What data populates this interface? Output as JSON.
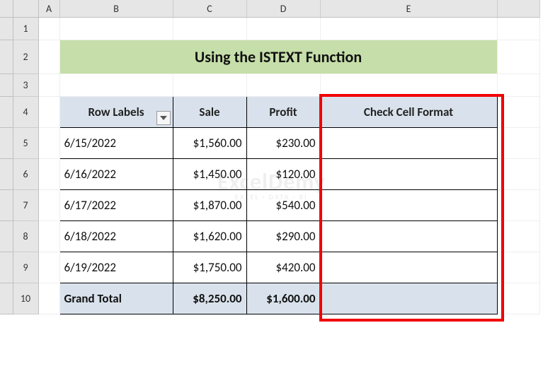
{
  "columns": [
    "A",
    "B",
    "C",
    "D",
    "E"
  ],
  "rows": [
    "1",
    "2",
    "3",
    "4",
    "5",
    "6",
    "7",
    "8",
    "9",
    "10"
  ],
  "title": "Using the ISTEXT Function",
  "headers": {
    "row_labels": "Row Labels",
    "sale": "Sale",
    "profit": "Profit",
    "check": "Check Cell Format"
  },
  "chart_data": {
    "type": "table",
    "columns": [
      "Row Labels",
      "Sale",
      "Profit",
      "Check Cell Format"
    ],
    "rows": [
      {
        "label": "6/15/2022",
        "sale": "$1,560.00",
        "profit": "$230.00",
        "check": ""
      },
      {
        "label": "6/16/2022",
        "sale": "$1,450.00",
        "profit": "$120.00",
        "check": ""
      },
      {
        "label": "6/17/2022",
        "sale": "$1,870.00",
        "profit": "$540.00",
        "check": ""
      },
      {
        "label": "6/18/2022",
        "sale": "$1,620.00",
        "profit": "$290.00",
        "check": ""
      },
      {
        "label": "6/19/2022",
        "sale": "$1,750.00",
        "profit": "$420.00",
        "check": ""
      }
    ],
    "totals": {
      "label": "Grand Total",
      "sale": "$8,250.00",
      "profit": "$1,600.00",
      "check": ""
    }
  },
  "watermark": {
    "main": "ExcelDemy",
    "sub": "EXCEL · DATA · BI"
  }
}
